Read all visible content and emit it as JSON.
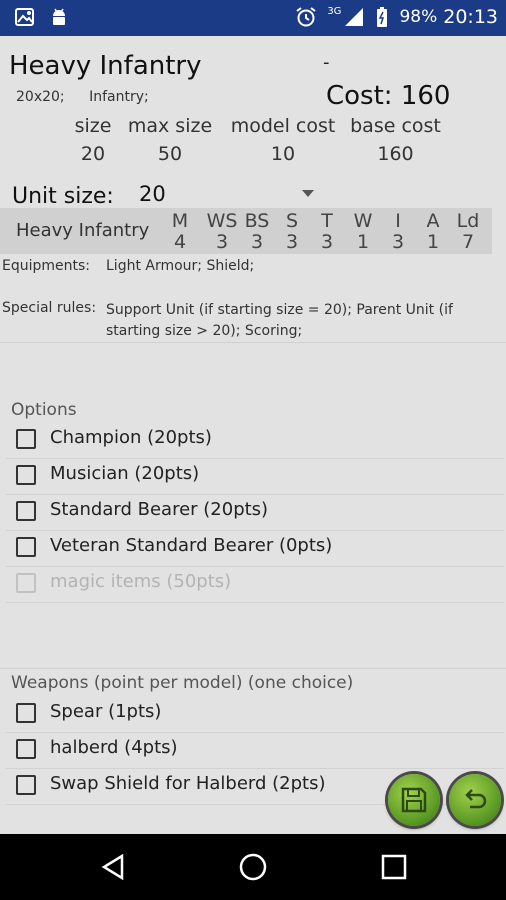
{
  "status_bar": {
    "battery": "98%",
    "time": "20:13",
    "network": "3G",
    "icons": [
      "image-notification-icon",
      "android-icon",
      "alarm-icon",
      "signal-icon",
      "battery-icon"
    ]
  },
  "header": {
    "unit_name": "Heavy Infantry",
    "dash": "-",
    "tags": [
      "20x20;",
      "Infantry;"
    ],
    "cost": "Cost: 160"
  },
  "stats_summary": {
    "headers": [
      "size",
      "max size",
      "model cost",
      "base cost"
    ],
    "values": [
      "20",
      "50",
      "10",
      "160"
    ]
  },
  "unit_size": {
    "label": "Unit size:",
    "value": "20"
  },
  "profile": {
    "name": "Heavy Infantry",
    "headers": [
      "M",
      "WS",
      "BS",
      "S",
      "T",
      "W",
      "I",
      "A",
      "Ld"
    ],
    "values": [
      "4",
      "3",
      "3",
      "3",
      "3",
      "1",
      "3",
      "1",
      "7"
    ]
  },
  "equipment": {
    "label": "Equipments:",
    "value": "Light Armour; Shield;"
  },
  "special_rules": {
    "label": "Special rules:",
    "value": "Support Unit (if starting size = 20); Parent Unit (if starting size > 20); Scoring;"
  },
  "options": {
    "title": "Options",
    "items": [
      {
        "label": "Champion (20pts)",
        "disabled": false
      },
      {
        "label": "Musician (20pts)",
        "disabled": false
      },
      {
        "label": "Standard Bearer (20pts)",
        "disabled": false
      },
      {
        "label": "Veteran Standard Bearer (0pts)",
        "disabled": false
      },
      {
        "label": "magic items (50pts)",
        "disabled": true
      }
    ]
  },
  "weapons": {
    "title": "Weapons (point per model) (one choice)",
    "items": [
      {
        "label": "Spear (1pts)"
      },
      {
        "label": "halberd (4pts)"
      },
      {
        "label": "Swap Shield for Halberd (2pts)"
      }
    ]
  },
  "fab_buttons": [
    "save-icon",
    "undo-icon"
  ],
  "nav": [
    "back-icon",
    "home-icon",
    "recents-icon"
  ],
  "colors": {
    "status_bar": "#1b3b86",
    "background": "#e2e2e2",
    "stats_band": "#d0d0d0",
    "fab_green": "#6aa82c"
  }
}
